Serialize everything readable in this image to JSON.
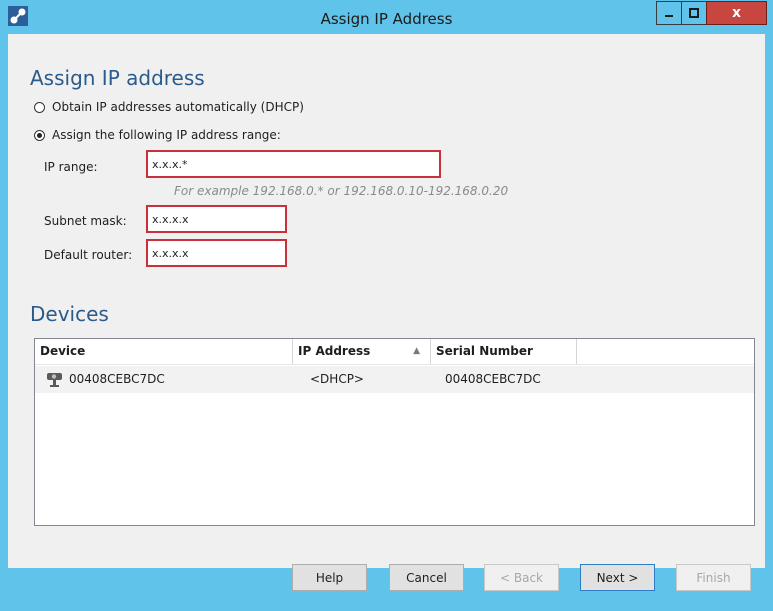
{
  "window": {
    "title": "Assign IP Address",
    "close_glyph": "x"
  },
  "assign": {
    "heading": "Assign IP address",
    "option_dhcp": "Obtain IP addresses automatically (DHCP)",
    "option_range": "Assign the following IP address range:",
    "selected_option": "range",
    "ip_range_label": "IP range:",
    "ip_range_value": "x.x.x.*",
    "ip_range_hint": "For example 192.168.0.* or 192.168.0.10-192.168.0.20",
    "subnet_label": "Subnet mask:",
    "subnet_value": "x.x.x.x",
    "router_label": "Default router:",
    "router_value": "x.x.x.x"
  },
  "devices": {
    "heading": "Devices",
    "columns": [
      "Device",
      "IP Address",
      "Serial Number"
    ],
    "sorted_column": "IP Address",
    "sort_direction": "ascending",
    "rows": [
      {
        "icon": "camera-icon",
        "device": "00408CEBC7DC",
        "ip": "<DHCP>",
        "serial": "00408CEBC7DC"
      }
    ]
  },
  "footer": {
    "help": "Help",
    "cancel": "Cancel",
    "back": "< Back",
    "next": "Next >",
    "finish": "Finish"
  },
  "colors": {
    "titlebar": "#5fc3ea",
    "heading": "#2a5b8c",
    "field_border_error": "#c8303a",
    "close_button": "#c7463f"
  }
}
